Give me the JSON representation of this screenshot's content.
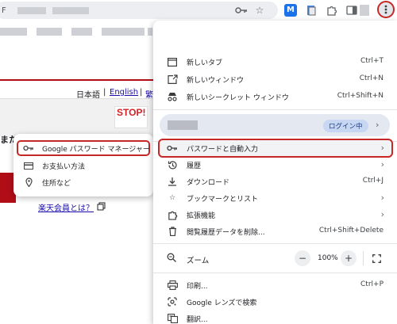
{
  "browser": {
    "address_fragment": "F",
    "extension_letter": "M"
  },
  "page": {
    "lang_current": "日本語",
    "lang_sep": "|",
    "lang_english": "English",
    "lang_more": "繁",
    "stop_logo": "STOP!",
    "side_text": "また",
    "member_link": "楽天会員とは？"
  },
  "submenu": {
    "items": [
      {
        "label": "Google パスワード マネージャー",
        "icon": "key-icon"
      },
      {
        "label": "お支払い方法",
        "icon": "credit-card-icon"
      },
      {
        "label": "住所など",
        "icon": "location-pin-icon"
      }
    ]
  },
  "menu": {
    "new_tab": {
      "label": "新しいタブ",
      "shortcut": "Ctrl+T"
    },
    "new_window": {
      "label": "新しいウィンドウ",
      "shortcut": "Ctrl+N"
    },
    "incognito": {
      "label": "新しいシークレット ウィンドウ",
      "shortcut": "Ctrl+Shift+N"
    },
    "profile": {
      "badge": "ログイン中"
    },
    "passwords": {
      "label": "パスワードと自動入力"
    },
    "history": {
      "label": "履歴"
    },
    "downloads": {
      "label": "ダウンロード",
      "shortcut": "Ctrl+J"
    },
    "bookmarks": {
      "label": "ブックマークとリスト"
    },
    "extensions": {
      "label": "拡張機能"
    },
    "clear_data": {
      "label": "閲覧履歴データを削除...",
      "shortcut": "Ctrl+Shift+Delete"
    },
    "zoom": {
      "label": "ズーム",
      "minus": "−",
      "value": "100%",
      "plus": "+"
    },
    "print": {
      "label": "印刷...",
      "shortcut": "Ctrl+P"
    },
    "lens": {
      "label": "Google レンズで検索"
    },
    "translate": {
      "label": "翻訳..."
    }
  },
  "colors": {
    "highlight_border": "#c62828",
    "brand_red": "#b10d17",
    "badge_bg": "#c7d6f3"
  }
}
